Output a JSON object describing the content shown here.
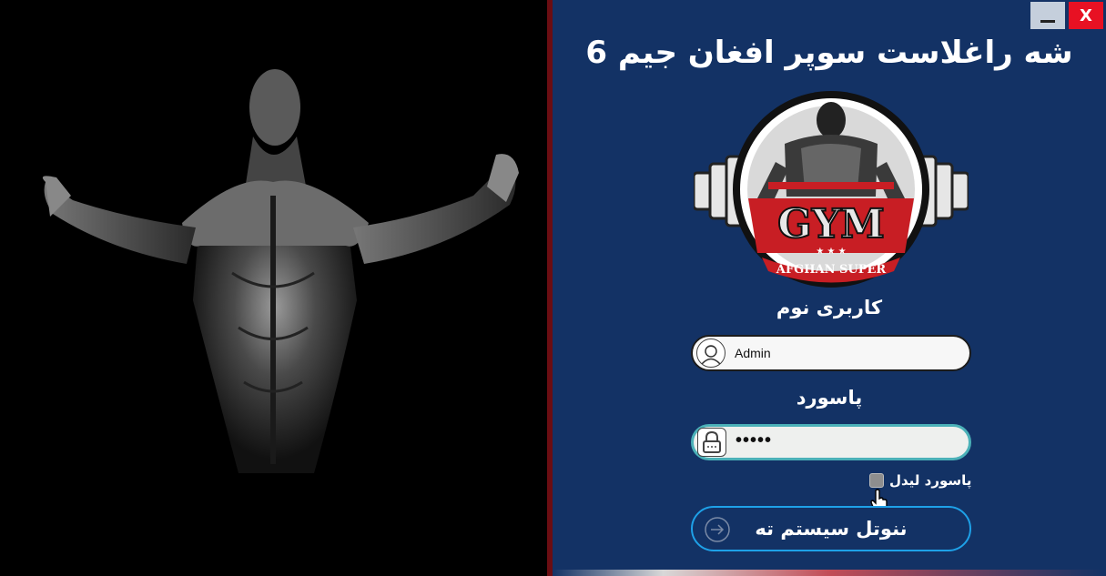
{
  "window": {
    "title": "شه راغلاست سوپر افغان جیم 6",
    "minimize_label": "_",
    "close_label": "X"
  },
  "logo": {
    "main_text": "GYM",
    "sub_text": "AFGHAN SUPER",
    "stars": "★ ★ ★"
  },
  "form": {
    "username_label": "کاربری نوم",
    "username_value": "Admin",
    "password_label": "پاسورد",
    "password_value": "•••••",
    "show_password_label": "پاسورد لیدل",
    "login_label": "ننوتل سیستم ته"
  },
  "colors": {
    "panel_bg": "#133265",
    "accent_blue": "#1ea1e8",
    "password_border": "#4bb1b8",
    "close_red": "#e81123"
  }
}
